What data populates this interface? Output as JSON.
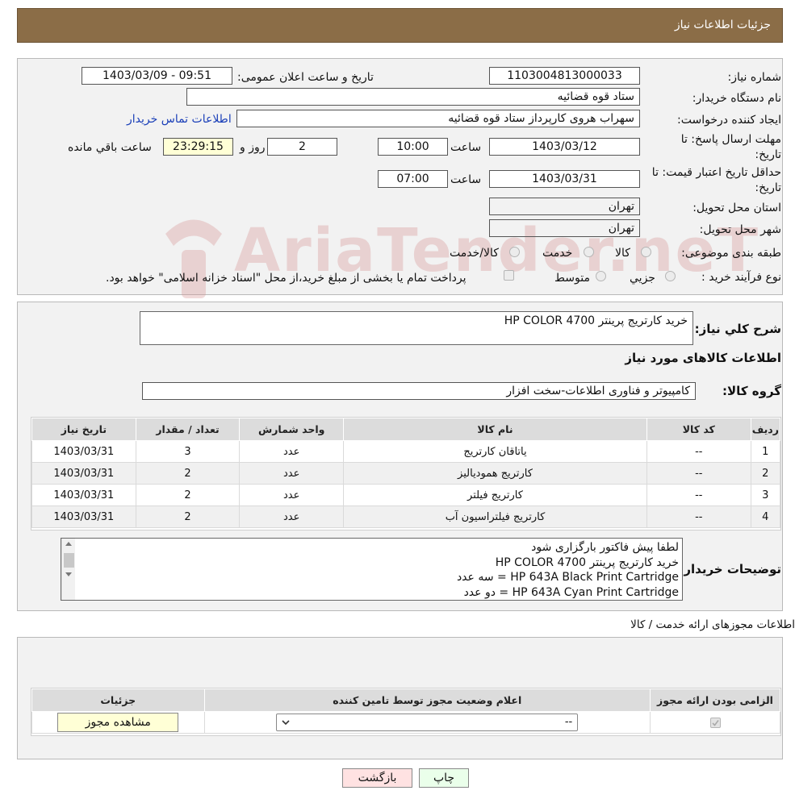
{
  "header": {
    "title": "جزئیات اطلاعات نیاز"
  },
  "info": {
    "need_number_label": "شماره نیاز:",
    "need_number": "1103004813000033",
    "announce_label": "تاریخ و ساعت اعلان عمومی:",
    "announce_value": "1403/03/09 - 09:51",
    "buyer_org_label": "نام دستگاه خریدار:",
    "buyer_org": "ستاد قوه قضائیه",
    "creator_label": "ایجاد کننده درخواست:",
    "creator": "سهراب هروی کارپرداز ستاد قوه قضائیه",
    "contact_link": "اطلاعات تماس خریدار",
    "deadline_label_1": "مهلت ارسال پاسخ: تا",
    "deadline_label_2": "تاریخ:",
    "deadline_date": "1403/03/12",
    "time_label": "ساعت",
    "deadline_time": "10:00",
    "days_value": "2",
    "days_label": "روز و",
    "remaining_value": "23:29:15",
    "remaining_label": "ساعت باقي مانده",
    "validity_label_1": "حداقل تاریخ اعتبار قیمت: تا",
    "validity_label_2": "تاریخ:",
    "validity_date": "1403/03/31",
    "validity_time": "07:00",
    "province_label": "استان محل تحویل:",
    "province": "تهران",
    "city_label": "شهر محل تحویل:",
    "city": "تهران",
    "category_label": "طبقه بندی موضوعی:",
    "category_options": [
      "کالا",
      "خدمت",
      "کالا/خدمت"
    ],
    "process_label": "نوع فرآیند خرید :",
    "process_options": [
      "جزیي",
      "متوسط"
    ],
    "payment_note": "پرداخت تمام یا بخشی از مبلغ خرید،از محل \"اسناد خزانه اسلامی\" خواهد بود."
  },
  "watermark": "AriaTender.neT",
  "summary": {
    "description_label": "شرح کلي نياز:",
    "description": "خرید کارتریج پرینتر HP COLOR 4700",
    "goods_info_title": "اطلاعات کالاهای مورد نیاز",
    "goods_group_label": "گروه کالا:",
    "goods_group": "کامپیوتر و فناوری اطلاعات-سخت افزار"
  },
  "goods_table": {
    "headers": [
      "ردیف",
      "کد کالا",
      "نام کالا",
      "واحد شمارش",
      "تعداد / مقدار",
      "تاریخ نیاز"
    ],
    "rows": [
      [
        "1",
        "--",
        "یاتاقان کارتریج",
        "عدد",
        "3",
        "1403/03/31"
      ],
      [
        "2",
        "--",
        "کارتریج هموديالیز",
        "عدد",
        "2",
        "1403/03/31"
      ],
      [
        "3",
        "--",
        "کارتریج فیلتر",
        "عدد",
        "2",
        "1403/03/31"
      ],
      [
        "4",
        "--",
        "کارتریج فیلتراسیون آب",
        "عدد",
        "2",
        "1403/03/31"
      ]
    ]
  },
  "buyer_notes": {
    "label": "توضیحات خریدار:",
    "lines": [
      "لطفا پیش فاکتور بارگزاری شود",
      "خرید کارتریج پرینتر HP COLOR 4700",
      "HP 643A Black Print Cartridge  =  سه عدد",
      "HP 643A Cyan Print Cartridge = دو عدد"
    ]
  },
  "permits": {
    "section_title": "اطلاعات مجوزهای ارائه خدمت / کالا",
    "headers": [
      "الزامی بودن ارائه مجوز",
      "اعلام وضعیت مجوز توسط تامین کننده",
      "جزئیات"
    ],
    "select_value": "--",
    "view_button": "مشاهده مجوز"
  },
  "footer": {
    "print_button": "چاپ",
    "back_button": "بازگشت"
  }
}
